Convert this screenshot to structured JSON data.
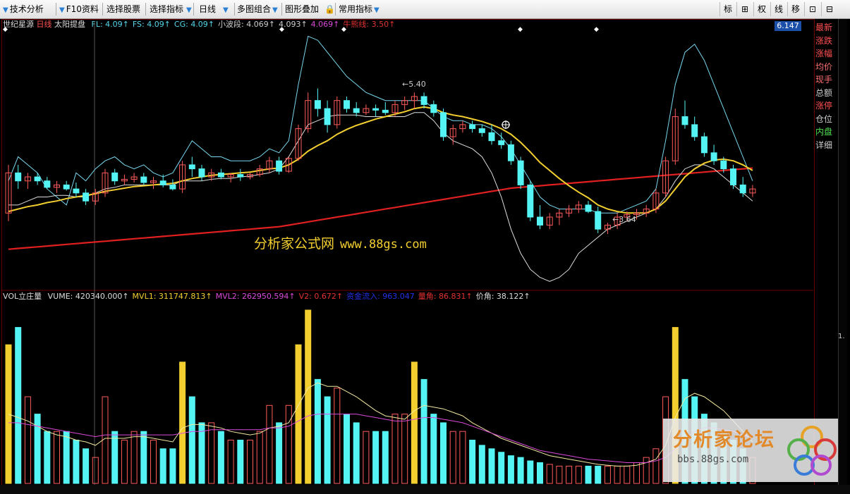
{
  "toolbar": {
    "items": [
      "技术分析",
      "F10资料",
      "选择股票",
      "选择指标",
      "日线",
      "多图组合",
      "图形叠加",
      "常用指标"
    ],
    "right": [
      "标",
      "⊞",
      "权",
      "线",
      "移",
      "⊡",
      "⊟"
    ]
  },
  "main_header": {
    "name": "世纪星源",
    "period": "日线",
    "indicator": "太阳提盘",
    "fields": [
      {
        "text": "FL: 4.09↑",
        "color": "#52d6e8"
      },
      {
        "text": "FS: 4.09↑",
        "color": "#52d6e8"
      },
      {
        "text": "CG: 4.09↑",
        "color": "#52d6e8"
      },
      {
        "text": "小波段: 4.069↑",
        "color": "#cccccc"
      },
      {
        "text": "4.093↑",
        "color": "#cccccc"
      },
      {
        "text": "4.069↑",
        "color": "#d84ad8"
      },
      {
        "text": "牛熊线: 3.50↑",
        "color": "#e23030"
      }
    ]
  },
  "vol_header": {
    "name": "VOL立庄量",
    "fields": [
      {
        "text": "VUME: 420340.000↑",
        "color": "#dddddd"
      },
      {
        "text": "MVL1: 311747.813↑",
        "color": "#f2cf2f"
      },
      {
        "text": "MVL2: 262950.594↑",
        "color": "#d84ad8"
      },
      {
        "text": "V2: 0.672↑",
        "color": "#e23030"
      },
      {
        "text": "资金流入: 963.047",
        "color": "#2030e8"
      },
      {
        "text": "量角: 86.831↑",
        "color": "#e23030"
      },
      {
        "text": "价角: 38.122↑",
        "color": "#dddddd"
      }
    ]
  },
  "price_box": "6.147",
  "right_panel": [
    {
      "label": "最新",
      "color": "#ff5050"
    },
    {
      "label": "涨跌",
      "color": "#ff5050"
    },
    {
      "label": "涨幅",
      "color": "#ff5050"
    },
    {
      "label": "均价",
      "color": "#ff7070"
    },
    {
      "label": "现手",
      "color": "#ff7070"
    },
    {
      "label": "总额",
      "color": "#cccccc"
    },
    {
      "label": "涨停",
      "color": "#ff5050"
    },
    {
      "label": "仓位",
      "color": "#cccccc"
    },
    {
      "label": "内盘",
      "color": "#50e050"
    },
    {
      "label": "详细",
      "color": "#cccccc"
    }
  ],
  "annotations": {
    "high": "5.40",
    "low": "3.64",
    "axis_mark": "1."
  },
  "watermark": {
    "text": "分析家公式网",
    "url": "www.88gs.com"
  },
  "logo": {
    "title": "分析家论坛",
    "url": "bbs.88gs.com"
  },
  "colors": {
    "up": "#ff5a5a",
    "down": "#54f4f4",
    "ma_yellow": "#f2cf2f",
    "bull_bear": "#e02020",
    "band": "#7ad8f0"
  },
  "chart_data": {
    "type": "candlestick",
    "ohlc": [
      [
        3.9,
        4.5,
        3.8,
        4.4
      ],
      [
        4.4,
        4.5,
        4.2,
        4.3
      ],
      [
        4.3,
        4.4,
        4.2,
        4.35
      ],
      [
        4.35,
        4.4,
        4.25,
        4.3
      ],
      [
        4.3,
        4.35,
        4.2,
        4.22
      ],
      [
        4.22,
        4.3,
        4.15,
        4.25
      ],
      [
        4.25,
        4.3,
        4.18,
        4.2
      ],
      [
        4.2,
        4.28,
        4.1,
        4.15
      ],
      [
        4.15,
        4.2,
        4.0,
        4.05
      ],
      [
        4.05,
        4.2,
        4.0,
        4.15
      ],
      [
        4.15,
        4.45,
        4.1,
        4.4
      ],
      [
        4.4,
        4.45,
        4.25,
        4.3
      ],
      [
        4.3,
        4.38,
        4.25,
        4.32
      ],
      [
        4.32,
        4.4,
        4.28,
        4.35
      ],
      [
        4.35,
        4.4,
        4.25,
        4.28
      ],
      [
        4.28,
        4.35,
        4.2,
        4.3
      ],
      [
        4.3,
        4.38,
        4.22,
        4.25
      ],
      [
        4.25,
        4.32,
        4.18,
        4.2
      ],
      [
        4.2,
        4.55,
        4.15,
        4.5
      ],
      [
        4.5,
        4.6,
        4.35,
        4.45
      ],
      [
        4.45,
        4.5,
        4.3,
        4.35
      ],
      [
        4.35,
        4.45,
        4.3,
        4.4
      ],
      [
        4.4,
        4.45,
        4.32,
        4.35
      ],
      [
        4.35,
        4.4,
        4.28,
        4.38
      ],
      [
        4.38,
        4.45,
        4.3,
        4.35
      ],
      [
        4.35,
        4.4,
        4.32,
        4.38
      ],
      [
        4.38,
        4.5,
        4.35,
        4.45
      ],
      [
        4.45,
        4.6,
        4.4,
        4.55
      ],
      [
        4.55,
        4.6,
        4.38,
        4.42
      ],
      [
        4.42,
        4.6,
        4.4,
        4.58
      ],
      [
        4.58,
        5.0,
        4.55,
        4.95
      ],
      [
        4.95,
        5.4,
        4.9,
        5.3
      ],
      [
        5.3,
        5.45,
        5.1,
        5.2
      ],
      [
        5.2,
        5.3,
        4.9,
        5.0
      ],
      [
        5.0,
        5.35,
        4.95,
        5.3
      ],
      [
        5.3,
        5.35,
        5.15,
        5.2
      ],
      [
        5.2,
        5.28,
        5.1,
        5.15
      ],
      [
        5.15,
        5.25,
        5.12,
        5.2
      ],
      [
        5.2,
        5.25,
        5.1,
        5.18
      ],
      [
        5.18,
        5.28,
        5.12,
        5.15
      ],
      [
        5.15,
        5.3,
        5.1,
        5.25
      ],
      [
        5.25,
        5.35,
        5.18,
        5.3
      ],
      [
        5.3,
        5.4,
        5.2,
        5.35
      ],
      [
        5.35,
        5.4,
        5.2,
        5.25
      ],
      [
        5.25,
        5.3,
        5.1,
        5.15
      ],
      [
        5.15,
        5.2,
        4.8,
        4.85
      ],
      [
        4.85,
        5.0,
        4.75,
        4.95
      ],
      [
        4.95,
        5.05,
        4.9,
        5.0
      ],
      [
        5.0,
        5.05,
        4.9,
        4.95
      ],
      [
        4.95,
        5.0,
        4.85,
        4.9
      ],
      [
        4.9,
        5.0,
        4.75,
        4.8
      ],
      [
        4.8,
        4.9,
        4.7,
        4.75
      ],
      [
        4.75,
        4.8,
        4.5,
        4.55
      ],
      [
        4.55,
        4.6,
        4.2,
        4.25
      ],
      [
        4.25,
        4.3,
        3.8,
        3.85
      ],
      [
        3.85,
        4.0,
        3.7,
        3.75
      ],
      [
        3.75,
        3.9,
        3.7,
        3.85
      ],
      [
        3.85,
        3.95,
        3.75,
        3.9
      ],
      [
        3.9,
        4.0,
        3.85,
        3.95
      ],
      [
        3.95,
        4.05,
        3.9,
        4.0
      ],
      [
        4.0,
        4.05,
        3.9,
        3.92
      ],
      [
        3.92,
        3.98,
        3.65,
        3.7
      ],
      [
        3.7,
        3.78,
        3.64,
        3.75
      ],
      [
        3.75,
        3.9,
        3.7,
        3.85
      ],
      [
        3.85,
        3.92,
        3.8,
        3.88
      ],
      [
        3.88,
        3.95,
        3.82,
        3.9
      ],
      [
        3.9,
        4.0,
        3.85,
        3.95
      ],
      [
        3.95,
        4.2,
        3.9,
        4.15
      ],
      [
        4.15,
        4.6,
        4.1,
        4.55
      ],
      [
        4.55,
        5.2,
        4.5,
        5.1
      ],
      [
        5.1,
        5.3,
        4.95,
        5.0
      ],
      [
        5.0,
        5.1,
        4.8,
        4.85
      ],
      [
        4.85,
        4.9,
        4.6,
        4.65
      ],
      [
        4.65,
        4.75,
        4.5,
        4.55
      ],
      [
        4.55,
        4.6,
        4.4,
        4.45
      ],
      [
        4.45,
        4.5,
        4.2,
        4.25
      ],
      [
        4.25,
        4.35,
        4.1,
        4.15
      ],
      [
        4.15,
        4.25,
        4.1,
        4.2
      ]
    ],
    "ma_yellow": [
      3.92,
      3.95,
      3.98,
      4.0,
      4.03,
      4.05,
      4.08,
      4.1,
      4.12,
      4.14,
      4.17,
      4.19,
      4.21,
      4.23,
      4.24,
      4.25,
      4.26,
      4.27,
      4.3,
      4.33,
      4.35,
      4.37,
      4.38,
      4.39,
      4.4,
      4.41,
      4.43,
      4.45,
      4.46,
      4.5,
      4.57,
      4.67,
      4.74,
      4.8,
      4.88,
      4.94,
      4.99,
      5.03,
      5.07,
      5.1,
      5.13,
      5.16,
      5.2,
      5.22,
      5.2,
      5.15,
      5.12,
      5.1,
      5.07,
      5.04,
      5.0,
      4.95,
      4.88,
      4.78,
      4.66,
      4.53,
      4.43,
      4.33,
      4.24,
      4.16,
      4.09,
      4.0,
      3.95,
      3.92,
      3.9,
      3.9,
      3.9,
      3.95,
      4.05,
      4.2,
      4.35,
      4.45,
      4.52,
      4.56,
      4.57,
      4.55,
      4.5,
      4.43
    ],
    "bull_bear": [
      3.45,
      3.46,
      3.47,
      3.48,
      3.49,
      3.5,
      3.51,
      3.52,
      3.53,
      3.54,
      3.55,
      3.56,
      3.57,
      3.58,
      3.59,
      3.6,
      3.61,
      3.62,
      3.63,
      3.64,
      3.65,
      3.66,
      3.67,
      3.68,
      3.69,
      3.7,
      3.71,
      3.72,
      3.73,
      3.75,
      3.77,
      3.79,
      3.81,
      3.83,
      3.85,
      3.87,
      3.89,
      3.91,
      3.93,
      3.95,
      3.97,
      3.99,
      4.01,
      4.03,
      4.05,
      4.07,
      4.09,
      4.11,
      4.13,
      4.15,
      4.17,
      4.19,
      4.21,
      4.22,
      4.23,
      4.24,
      4.25,
      4.26,
      4.27,
      4.28,
      4.29,
      4.3,
      4.31,
      4.32,
      4.33,
      4.34,
      4.35,
      4.36,
      4.37,
      4.38,
      4.39,
      4.4,
      4.41,
      4.42,
      4.43,
      4.44,
      4.45,
      4.46
    ],
    "upper_band": [
      4.3,
      4.6,
      4.5,
      4.4,
      4.2,
      4.1,
      4.0,
      4.4,
      4.3,
      4.45,
      4.55,
      4.6,
      4.5,
      4.45,
      4.5,
      4.4,
      4.35,
      4.4,
      4.6,
      4.8,
      4.7,
      4.6,
      4.6,
      4.55,
      4.55,
      4.55,
      4.6,
      4.7,
      4.65,
      4.8,
      5.5,
      6.1,
      6.05,
      5.9,
      5.75,
      5.6,
      5.5,
      5.4,
      5.35,
      5.3,
      5.3,
      5.3,
      5.3,
      5.3,
      5.2,
      5.1,
      5.05,
      5.05,
      5.0,
      5.0,
      4.95,
      4.85,
      4.7,
      4.5,
      4.3,
      4.1,
      4.0,
      3.95,
      3.95,
      3.95,
      3.95,
      3.9,
      3.9,
      3.9,
      3.95,
      4.0,
      4.05,
      4.2,
      4.8,
      5.5,
      5.9,
      6.0,
      5.8,
      5.5,
      5.2,
      4.9,
      4.6,
      4.3
    ],
    "lower_band": [
      4.0,
      4.0,
      4.05,
      4.1,
      4.1,
      4.12,
      4.12,
      4.1,
      4.1,
      4.15,
      4.2,
      4.22,
      4.25,
      4.25,
      4.25,
      4.25,
      4.25,
      4.25,
      4.3,
      4.3,
      4.3,
      4.32,
      4.33,
      4.33,
      4.35,
      4.36,
      4.38,
      4.4,
      4.45,
      4.6,
      4.8,
      5.0,
      5.05,
      5.1,
      5.12,
      5.12,
      5.12,
      5.1,
      5.1,
      5.1,
      5.1,
      5.1,
      5.15,
      5.15,
      5.05,
      4.9,
      4.8,
      4.75,
      4.7,
      4.6,
      4.4,
      4.1,
      3.7,
      3.4,
      3.2,
      3.1,
      3.05,
      3.1,
      3.2,
      3.4,
      3.5,
      3.6,
      3.7,
      3.75,
      3.8,
      3.85,
      3.9,
      3.95,
      4.1,
      4.3,
      4.45,
      4.5,
      4.5,
      4.45,
      4.35,
      4.25,
      4.15,
      4.05
    ],
    "volume": [
      8,
      9,
      5,
      4,
      3,
      3,
      3,
      2.5,
      2,
      1.5,
      5,
      3,
      2.5,
      3,
      3,
      2.5,
      2,
      2,
      7,
      5,
      3.5,
      3.5,
      3,
      2.5,
      2.5,
      2.5,
      3,
      4.5,
      3.5,
      4.5,
      8,
      10,
      6,
      5,
      5.5,
      4,
      3.5,
      3,
      3,
      3,
      4,
      4,
      7,
      6,
      4,
      3.5,
      3,
      3,
      2.5,
      2.2,
      2,
      1.8,
      1.6,
      1.5,
      1.3,
      1.2,
      1.1,
      1,
      1,
      1,
      1,
      1,
      1,
      1,
      1,
      1.2,
      1.5,
      2,
      5,
      9,
      6,
      5,
      4,
      3.5,
      3,
      2.5,
      2,
      1.5
    ],
    "mvl1": [
      4,
      3.8,
      3.6,
      3.3,
      3,
      2.8,
      2.7,
      2.5,
      2.4,
      2.2,
      2.6,
      2.6,
      2.6,
      2.7,
      2.7,
      2.6,
      2.5,
      2.4,
      3.2,
      3.4,
      3.4,
      3.3,
      3.2,
      3.0,
      2.9,
      2.8,
      2.9,
      3.2,
      3.3,
      3.5,
      4.5,
      5.5,
      5.8,
      5.6,
      5.6,
      5.3,
      5.0,
      4.6,
      4.2,
      3.9,
      3.8,
      3.7,
      4.2,
      4.5,
      4.4,
      4.3,
      4.1,
      3.9,
      3.5,
      3.2,
      2.9,
      2.6,
      2.4,
      2.2,
      2.0,
      1.8,
      1.6,
      1.5,
      1.4,
      1.3,
      1.2,
      1.1,
      1.05,
      1.0,
      1.0,
      1.05,
      1.2,
      1.4,
      2.2,
      3.8,
      4.9,
      5.2,
      5.0,
      4.6,
      4.2,
      3.6,
      3.0,
      2.4
    ],
    "mvl2": [
      3.5,
      3.5,
      3.4,
      3.3,
      3.2,
      3.1,
      3.0,
      2.9,
      2.8,
      2.7,
      2.8,
      2.8,
      2.8,
      2.8,
      2.8,
      2.8,
      2.8,
      2.8,
      2.9,
      3.0,
      3.0,
      3.1,
      3.1,
      3.1,
      3.1,
      3.1,
      3.1,
      3.2,
      3.2,
      3.3,
      3.6,
      3.9,
      4.0,
      4.0,
      4.0,
      4.0,
      4.0,
      3.9,
      3.8,
      3.7,
      3.6,
      3.6,
      3.7,
      3.8,
      3.8,
      3.7,
      3.6,
      3.5,
      3.3,
      3.1,
      2.9,
      2.7,
      2.5,
      2.3,
      2.1,
      1.9,
      1.8,
      1.7,
      1.6,
      1.5,
      1.4,
      1.35,
      1.3,
      1.25,
      1.2,
      1.2,
      1.2,
      1.3,
      1.5,
      2.0,
      2.6,
      3.0,
      3.2,
      3.2,
      3.1,
      3.0,
      2.8,
      2.6
    ],
    "ylim": [
      3.0,
      6.2
    ]
  }
}
